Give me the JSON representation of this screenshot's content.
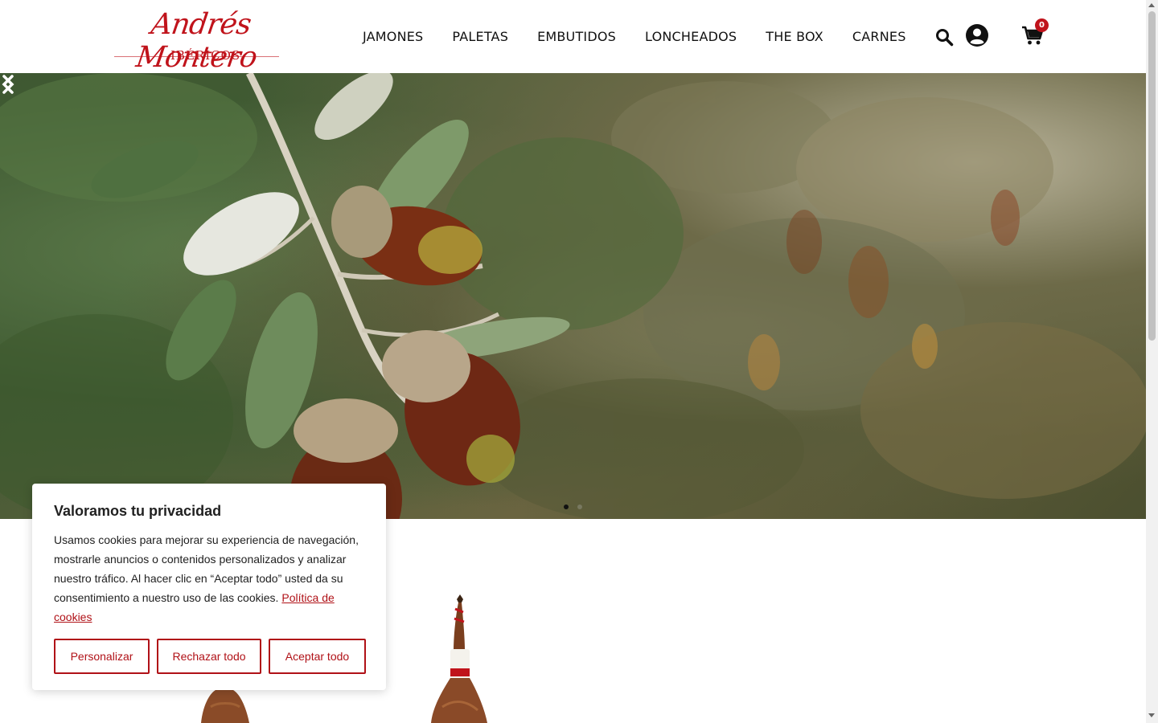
{
  "brand": {
    "name": "Andrés Montero",
    "sub": "IBÉRICOS"
  },
  "nav": {
    "items": [
      "JAMONES",
      "PALETAS",
      "EMBUTIDOS",
      "LONCHEADOS",
      "THE BOX",
      "CARNES"
    ]
  },
  "header_icons": {
    "search": "search-icon",
    "account": "account-icon",
    "cart": "cart-icon"
  },
  "cart": {
    "count": "0"
  },
  "hero": {
    "slides_total": 2,
    "active_slide": 1
  },
  "cookie": {
    "title": "Valoramos tu privacidad",
    "text": "Usamos cookies para mejorar su experiencia de navegación, mostrarle anuncios o contenidos personalizados y analizar nuestro tráfico. Al hacer clic en “Aceptar todo” usted da su consentimiento a nuestro uso de las cookies.",
    "link": "Política de cookies",
    "buttons": {
      "customize": "Personalizar",
      "reject": "Rechazar todo",
      "accept": "Aceptar todo"
    }
  },
  "colors": {
    "brand_red": "#c0131b",
    "button_red": "#b01117"
  }
}
